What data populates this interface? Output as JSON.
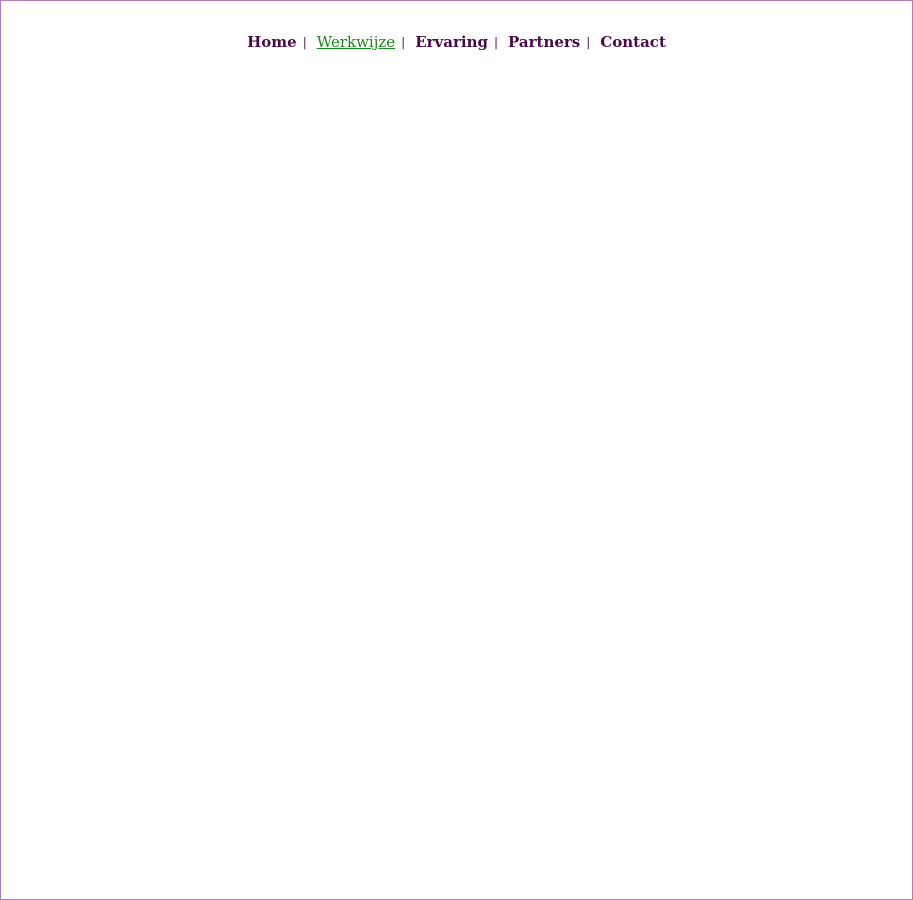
{
  "nav": {
    "items": [
      {
        "label": "Home",
        "active": false
      },
      {
        "label": "Werkwijze",
        "active": true
      },
      {
        "label": "Ervaring",
        "active": false
      },
      {
        "label": "Partners",
        "active": false
      },
      {
        "label": "Contact",
        "active": false
      }
    ],
    "separator": "|"
  },
  "colors": {
    "link": "#4a0a4a",
    "active_link": "#1a8a1a",
    "frame_border": "#b07cc6",
    "background": "#ffffff"
  }
}
